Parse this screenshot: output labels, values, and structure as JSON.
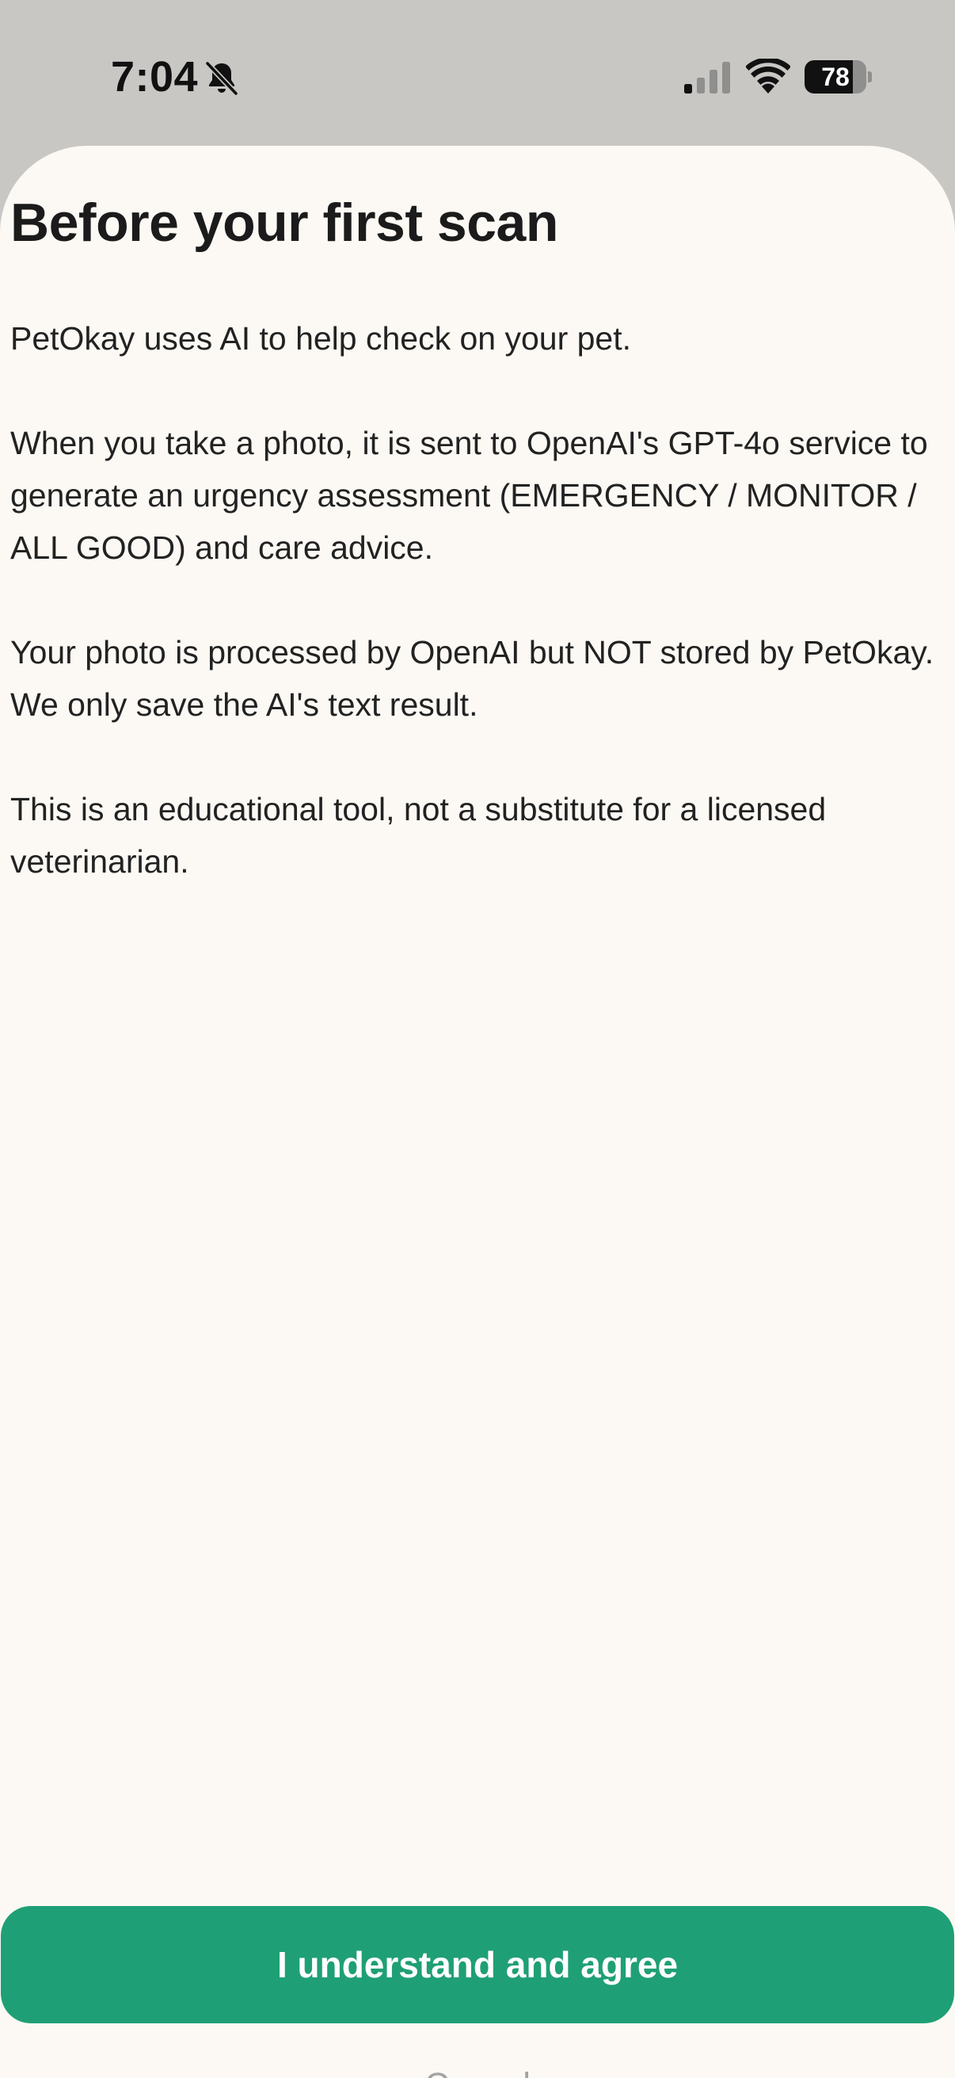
{
  "status_bar": {
    "time": "7:04",
    "battery_level": "78",
    "battery_fraction": 0.78,
    "icons": [
      "bell-slash-icon",
      "cellular-signal-icon",
      "wifi-icon",
      "battery-icon"
    ]
  },
  "sheet": {
    "title": "Before your first scan",
    "paragraphs": [
      "PetOkay uses AI to help check on your pet.",
      "When you take a photo, it is sent to OpenAI's GPT-4o service to generate an urgency assessment (EMERGENCY / MONITOR / ALL GOOD) and care advice.",
      "Your photo is processed by OpenAI but NOT stored by PetOkay. We only save the AI's text result.",
      "This is an educational tool, not a substitute for a licensed veterinarian."
    ],
    "agree_label": "I understand and agree",
    "cancel_label": "Cancel"
  },
  "colors": {
    "accent": "#1f9f75",
    "sheet_background": "#fcf9f4",
    "backdrop": "#c8c7c4",
    "muted_text": "#a3a3a3"
  }
}
